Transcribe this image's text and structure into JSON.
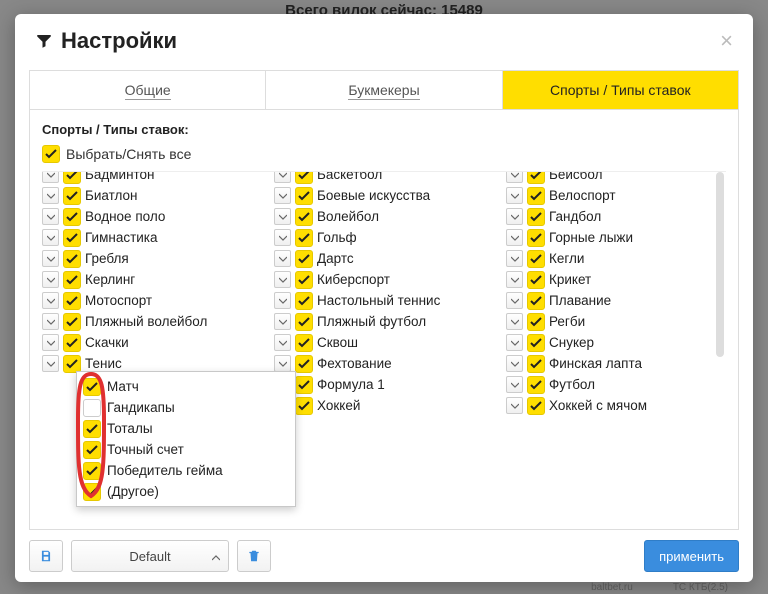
{
  "bg_header": "Всего вилок сейчас: 15489",
  "modal": {
    "title": "Настройки",
    "close": "×",
    "tabs": {
      "general": "Общие",
      "bookmakers": "Букмекеры",
      "sports": "Спорты / Типы ставок"
    },
    "section_label": "Спорты / Типы ставок:",
    "select_all": "Выбрать/Снять все"
  },
  "columns": {
    "col1": [
      {
        "label": "Бадминтон",
        "checked": true,
        "cut": true
      },
      {
        "label": "Биатлон",
        "checked": true
      },
      {
        "label": "Водное поло",
        "checked": true
      },
      {
        "label": "Гимнастика",
        "checked": true
      },
      {
        "label": "Гребля",
        "checked": true
      },
      {
        "label": "Керлинг",
        "checked": true
      },
      {
        "label": "Мотоспорт",
        "checked": true
      },
      {
        "label": "Пляжный волейбол",
        "checked": true
      },
      {
        "label": "Скачки",
        "checked": true
      },
      {
        "label": "Тенис",
        "checked": true,
        "expanded": true
      }
    ],
    "col2": [
      {
        "label": "Баскетбол",
        "checked": true,
        "cut": true
      },
      {
        "label": "Боевые искусства",
        "checked": true
      },
      {
        "label": "Волейбол",
        "checked": true
      },
      {
        "label": "Гольф",
        "checked": true
      },
      {
        "label": "Дартс",
        "checked": true
      },
      {
        "label": "Киберспорт",
        "checked": true
      },
      {
        "label": "Настольный теннис",
        "checked": true
      },
      {
        "label": "Пляжный футбол",
        "checked": true
      },
      {
        "label": "Сквош",
        "checked": true
      },
      {
        "label": "Фехтование",
        "checked": true
      },
      {
        "label": "Формула 1",
        "checked": true
      },
      {
        "label": "Хоккей",
        "checked": true
      }
    ],
    "col3": [
      {
        "label": "Бейсбол",
        "checked": true,
        "cut": true
      },
      {
        "label": "Велоспорт",
        "checked": true
      },
      {
        "label": "Гандбол",
        "checked": true
      },
      {
        "label": "Горные лыжи",
        "checked": true
      },
      {
        "label": "Кегли",
        "checked": true
      },
      {
        "label": "Крикет",
        "checked": true
      },
      {
        "label": "Плавание",
        "checked": true
      },
      {
        "label": "Регби",
        "checked": true
      },
      {
        "label": "Снукер",
        "checked": true
      },
      {
        "label": "Финская лапта",
        "checked": true
      },
      {
        "label": "Футбол",
        "checked": true
      },
      {
        "label": "Хоккей с мячом",
        "checked": true
      }
    ]
  },
  "sub_items": [
    {
      "label": "Матч",
      "checked": true
    },
    {
      "label": "Гандикапы",
      "checked": false
    },
    {
      "label": "Тоталы",
      "checked": true
    },
    {
      "label": "Точный счет",
      "checked": true
    },
    {
      "label": "Победитель гейма",
      "checked": true
    },
    {
      "label": "(Другое)",
      "checked": true
    }
  ],
  "footer": {
    "preset": "Default",
    "apply": "применить"
  },
  "bg_footer": {
    "a": "baltbet.ru",
    "b": "ТС КТБ(2.5)"
  }
}
